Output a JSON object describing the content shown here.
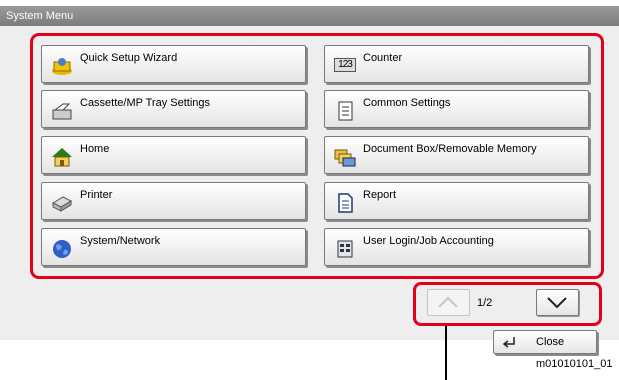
{
  "window": {
    "title": "System Menu"
  },
  "menu": {
    "items": [
      {
        "label": "Quick Setup Wizard",
        "icon": "wizard-icon"
      },
      {
        "label": "Counter",
        "icon": "counter-icon"
      },
      {
        "label": "Cassette/MP Tray Settings",
        "icon": "tray-icon"
      },
      {
        "label": "Common Settings",
        "icon": "common-settings-icon"
      },
      {
        "label": "Home",
        "icon": "home-icon"
      },
      {
        "label": "Document Box/Removable Memory",
        "icon": "document-box-icon"
      },
      {
        "label": "Printer",
        "icon": "printer-icon"
      },
      {
        "label": "Report",
        "icon": "report-icon"
      },
      {
        "label": "System/Network",
        "icon": "globe-icon"
      },
      {
        "label": "User Login/Job Accounting",
        "icon": "user-login-icon"
      }
    ],
    "counter_icon_text": "123"
  },
  "pager": {
    "indicator": "1/2"
  },
  "close": {
    "label": "Close"
  },
  "caption": "m01010101_01",
  "colors": {
    "highlight": "#e2001a",
    "titlebar": "#8a8a8a"
  }
}
